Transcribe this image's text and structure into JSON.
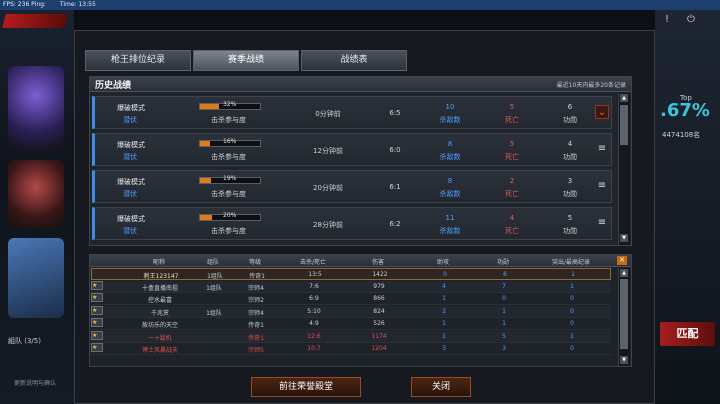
{
  "topbar": {
    "fps": "FPS: 236  Ping: ",
    "time": "Time: 13:55"
  },
  "left": {
    "squad": "組队 (3/5)",
    "notice": "更新说明与确认"
  },
  "right": {
    "top_label": "Top",
    "percent": ".67%",
    "number": "4474108名",
    "match_label": "匹配"
  },
  "tabs": [
    "枪王排位纪录",
    "赛季战绩",
    "战绩表"
  ],
  "history": {
    "title": "历史战绩",
    "note": "最近10天内最多20条记录",
    "rows": [
      {
        "mode": "爆破模式",
        "role": "潜伏",
        "progress_text": "32%",
        "progress": 0.32,
        "sub": "击杀参与度",
        "time": "0分钟前",
        "score": "6:5",
        "kills": "10",
        "kills_label": "杀敌数",
        "deaths": "5",
        "deaths_label": "死亡",
        "merit": "6",
        "merit_label": "功勋",
        "icon": "chevron-down"
      },
      {
        "mode": "爆破模式",
        "role": "潜伏",
        "progress_text": "16%",
        "progress": 0.16,
        "sub": "击杀参与度",
        "time": "12分钟前",
        "score": "6:0",
        "kills": "8",
        "kills_label": "杀敌数",
        "deaths": "5",
        "deaths_label": "死亡",
        "merit": "4",
        "merit_label": "功勋",
        "icon": "menu"
      },
      {
        "mode": "爆破模式",
        "role": "潜伏",
        "progress_text": "19%",
        "progress": 0.19,
        "sub": "击杀参与度",
        "time": "20分钟前",
        "score": "6:1",
        "kills": "8",
        "kills_label": "杀敌数",
        "deaths": "2",
        "deaths_label": "死亡",
        "merit": "3",
        "merit_label": "功勋",
        "icon": "menu"
      },
      {
        "mode": "爆破模式",
        "role": "潜伏",
        "progress_text": "20%",
        "progress": 0.2,
        "sub": "击杀参与度",
        "time": "28分钟前",
        "score": "6:2",
        "kills": "11",
        "kills_label": "杀敌数",
        "deaths": "4",
        "deaths_label": "死亡",
        "merit": "5",
        "merit_label": "功勋",
        "icon": "menu"
      }
    ]
  },
  "detail": {
    "headers": [
      "昵称",
      "组队",
      "等级",
      "击杀/死亡",
      "伤害",
      "助攻",
      "功勋",
      "突出/最高纪录"
    ],
    "rows": [
      {
        "name": "刺王123147",
        "team": "1组队",
        "rank": "传奇1",
        "kd": "13:5",
        "dmg": "1422",
        "assist": "0",
        "merit": "6",
        "best": "1",
        "self": true
      },
      {
        "name": "十盒直播南祖",
        "team": "1组队",
        "rank": "宗师4",
        "kd": "7:6",
        "dmg": "979",
        "assist": "4",
        "merit": "7",
        "best": "1"
      },
      {
        "name": "控水最富",
        "team": "",
        "rank": "宗师2",
        "kd": "6:9",
        "dmg": "866",
        "assist": "1",
        "merit": "0",
        "best": "0"
      },
      {
        "name": "千兆赏",
        "team": "1组队",
        "rank": "宗师4",
        "kd": "5:10",
        "dmg": "824",
        "assist": "2",
        "merit": "1",
        "best": "0"
      },
      {
        "name": "赦坊乐的天空",
        "team": "",
        "rank": "传奇1",
        "kd": "4:9",
        "dmg": "526",
        "assist": "1",
        "merit": "1",
        "best": "0"
      },
      {
        "name": "一+敌机",
        "team": "",
        "rank": "传奇1",
        "kd": "12:6",
        "dmg": "1174",
        "assist": "1",
        "merit": "5",
        "best": "1",
        "red": true
      },
      {
        "name": "博士风暴战夫",
        "team": "",
        "rank": "宗师5",
        "kd": "10:7",
        "dmg": "1204",
        "assist": "3",
        "merit": "3",
        "best": "0",
        "red": true
      }
    ]
  },
  "buttons": {
    "hall": "前往荣誉殿堂",
    "close": "关闭"
  }
}
